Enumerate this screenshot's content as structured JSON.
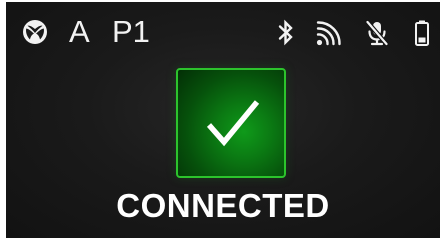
{
  "status_bar": {
    "platform_icon": "xbox-logo-icon",
    "account_letter": "A",
    "player_slot": "P1",
    "icons": [
      "bluetooth-icon",
      "cast-icon",
      "mic-muted-icon",
      "battery-icon"
    ]
  },
  "main": {
    "status_icon": "checkmark-icon",
    "status_text": "CONNECTED"
  },
  "colors": {
    "background": "#141414",
    "tile_border": "#2cc42c",
    "tile_fill": "#0b7a13",
    "text": "#ffffff"
  }
}
